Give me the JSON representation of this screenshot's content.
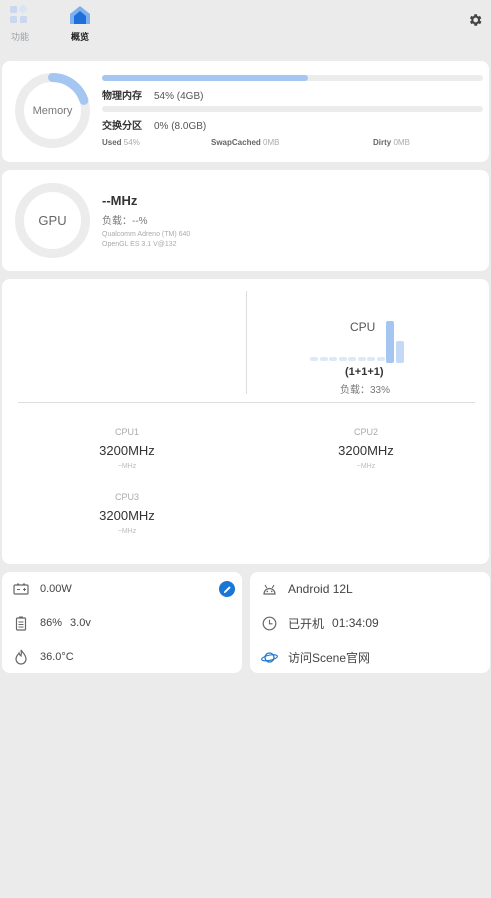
{
  "nav": {
    "tabs": [
      {
        "label": "功能",
        "icon": "apps-icon"
      },
      {
        "label": "概览",
        "icon": "home-icon"
      }
    ],
    "active_index": 1,
    "settings_icon": "gear-icon"
  },
  "memory": {
    "ring_label": "Memory",
    "ring_fraction": 0.2,
    "physical": {
      "label": "物理内存",
      "value": "54% (4GB)",
      "fraction": 0.54
    },
    "swap": {
      "label": "交换分区",
      "value": "0% (8.0GB)",
      "fraction": 0.0
    },
    "stats": {
      "used_label": "Used",
      "used_value": "54%",
      "swapcached_label": "SwapCached",
      "swapcached_value": "0MB",
      "dirty_label": "Dirty",
      "dirty_value": "0MB"
    }
  },
  "gpu": {
    "ring_label": "GPU",
    "freq": "--MHz",
    "load": "负载：--%",
    "model": "Qualcomm Adreno (TM) 640",
    "api": "OpenGL ES 3.1 V@132"
  },
  "cpu": {
    "title": "CPU",
    "cores_summary": "(1+1+1)",
    "load": "负载：33%",
    "history_bars": [
      0,
      0,
      0,
      0,
      0,
      0,
      0,
      0,
      0.95,
      0.5
    ],
    "cores": [
      {
        "name": "CPU1",
        "freq": "3200MHz",
        "sub": "~MHz"
      },
      {
        "name": "CPU2",
        "freq": "3200MHz",
        "sub": "~MHz"
      },
      {
        "name": "CPU3",
        "freq": "3200MHz",
        "sub": "~MHz"
      }
    ]
  },
  "power": {
    "wattage": "0.00W",
    "battery": "86%",
    "voltage": "3.0v",
    "temperature": "36.0°C",
    "accent": "#1976d2"
  },
  "system": {
    "android": "Android 12L",
    "uptime_label": "已开机",
    "uptime": "01:34:09",
    "scene_link": "访问Scene官网"
  }
}
